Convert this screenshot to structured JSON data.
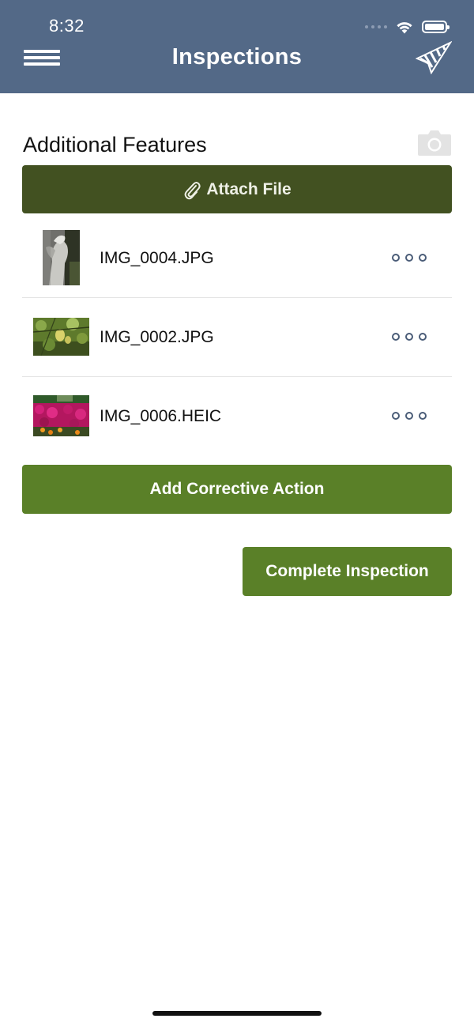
{
  "status_bar": {
    "time": "8:32"
  },
  "header": {
    "title": "Inspections",
    "menu_icon": "hamburger-menu-icon",
    "logo_icon": "app-logo-icon",
    "background": "#536987"
  },
  "section": {
    "title": "Additional Features",
    "camera_icon": "camera-icon"
  },
  "attach_button": {
    "label": "Attach File",
    "icon": "paperclip-icon",
    "color": "#425121"
  },
  "files": [
    {
      "name": "IMG_0004.JPG",
      "thumbnail": "statue-photo",
      "menu_icon": "more-options-icon"
    },
    {
      "name": "IMG_0002.JPG",
      "thumbnail": "lemon-tree-photo",
      "menu_icon": "more-options-icon"
    },
    {
      "name": "IMG_0006.HEIC",
      "thumbnail": "flower-bed-photo",
      "menu_icon": "more-options-icon"
    }
  ],
  "actions": {
    "corrective_label": "Add Corrective Action",
    "complete_label": "Complete Inspection",
    "color": "#5a8028"
  }
}
